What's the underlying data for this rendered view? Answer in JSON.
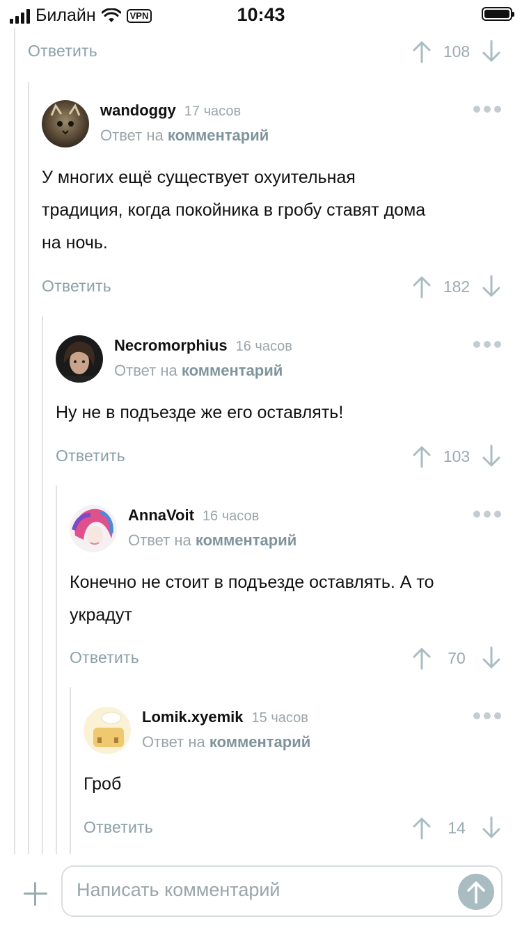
{
  "status_bar": {
    "carrier": "Билайн",
    "vpn": "VPN",
    "time": "10:43"
  },
  "labels": {
    "reply": "Ответить",
    "reply_to_prefix": "Ответ на",
    "reply_to_link": "комментарий"
  },
  "first_action": {
    "votes": "108"
  },
  "comments": [
    {
      "username": "wandoggy",
      "time": "17 часов",
      "text_lines": [
        "У многих ещё существует охуительная",
        "традиция, когда покойника в гробу ставят дома",
        "на ночь."
      ],
      "votes": "182"
    },
    {
      "username": "Necromorphius",
      "time": "16 часов",
      "text_lines": [
        "Ну не в подъезде же его оставлять!"
      ],
      "votes": "103"
    },
    {
      "username": "AnnaVoit",
      "time": "16 часов",
      "text_lines": [
        "Конечно не стоит в подъезде оставлять. А то",
        "украдут"
      ],
      "votes": "70"
    },
    {
      "username": "Lomik.xyemik",
      "time": "15 часов",
      "text_lines": [
        "Гроб"
      ],
      "votes": "14"
    }
  ],
  "composer": {
    "placeholder": "Написать комментарий"
  }
}
